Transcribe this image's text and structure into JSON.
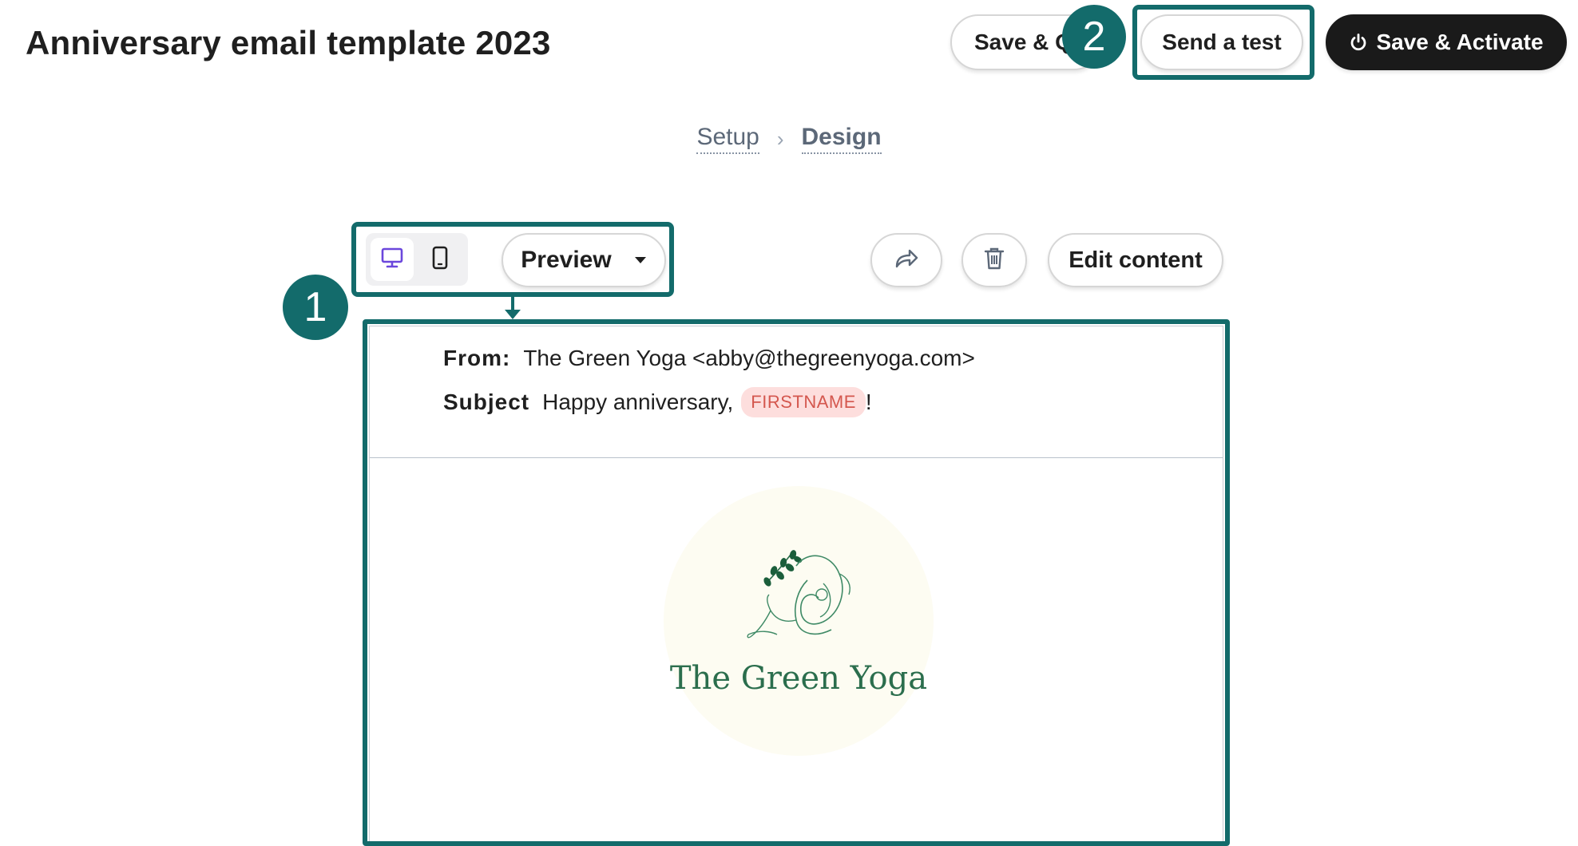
{
  "header": {
    "title": "Anniversary email template 2023",
    "save_quit_label": "Save & Q",
    "send_test_label": "Send a test",
    "activate_label": "Save & Activate"
  },
  "breadcrumb": {
    "setup": "Setup",
    "design": "Design"
  },
  "annotations": {
    "badge_1": "1",
    "badge_2": "2",
    "color": "#136b6b"
  },
  "toolbar": {
    "device_selected": "desktop",
    "preview_label": "Preview",
    "edit_label": "Edit content"
  },
  "email": {
    "from_label": "From:",
    "from_value": "The Green Yoga <abby@thegreenyoga.com>",
    "subject_label": "Subject",
    "subject_value": "Happy anniversary,",
    "subject_tag": "FIRSTNAME",
    "subject_suffix": "!",
    "logo_text": "The Green Yoga"
  },
  "colors": {
    "accent": "#136b6b",
    "primary_button": "#1a1a1a",
    "tag_bg": "#fddedd",
    "tag_text": "#d4574e",
    "logo_green": "#2b6e4d"
  }
}
